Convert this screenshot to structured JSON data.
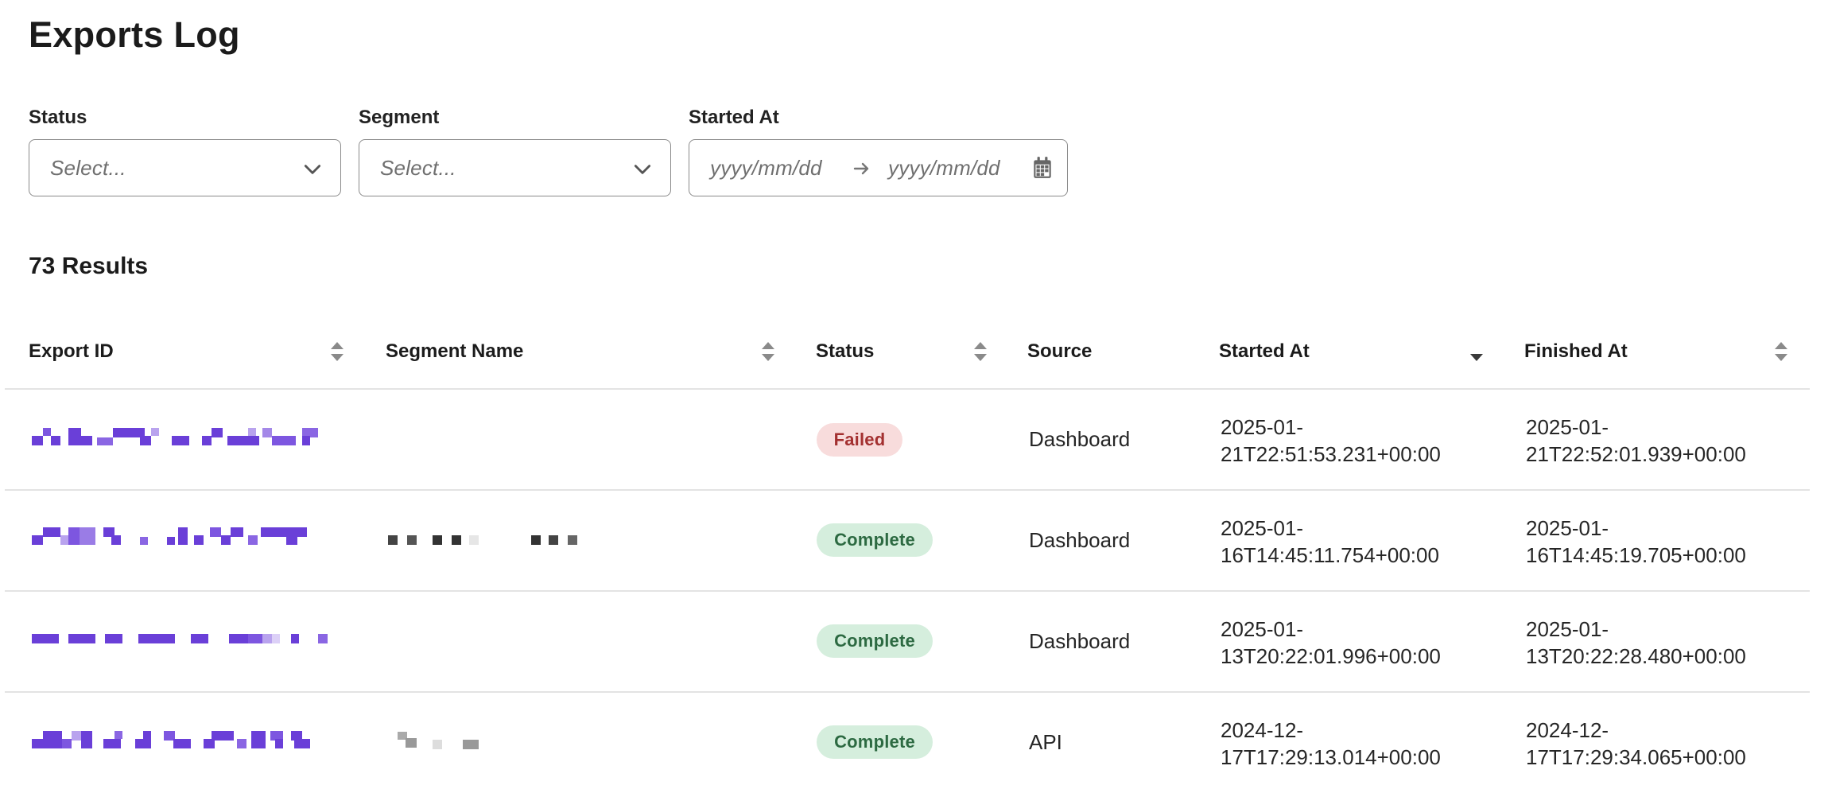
{
  "page": {
    "title": "Exports Log"
  },
  "filters": {
    "status": {
      "label": "Status",
      "placeholder": "Select..."
    },
    "segment": {
      "label": "Segment",
      "placeholder": "Select..."
    },
    "started_at": {
      "label": "Started At",
      "from_placeholder": "yyyy/mm/dd",
      "to_placeholder": "yyyy/mm/dd"
    }
  },
  "results_count": "73 Results",
  "table": {
    "columns": [
      {
        "label": "Export ID",
        "sort": "unsorted"
      },
      {
        "label": "Segment Name",
        "sort": "unsorted"
      },
      {
        "label": "Status",
        "sort": "unsorted"
      },
      {
        "label": "Source",
        "sort": "none"
      },
      {
        "label": "Started At",
        "sort": "descending"
      },
      {
        "label": "Finished At",
        "sort": "unsorted"
      }
    ],
    "rows": [
      {
        "status": "Failed",
        "status_color": "#a33030",
        "source": "Dashboard",
        "started_line1": "2025-01-",
        "started_line2": "21T22:51:53.231+00:00",
        "finished_line1": "2025-01-",
        "finished_line2": "21T22:52:01.939+00:00"
      },
      {
        "status": "Complete",
        "status_color": "#2d6a42",
        "source": "Dashboard",
        "started_line1": "2025-01-",
        "started_line2": "16T14:45:11.754+00:00",
        "finished_line1": "2025-01-",
        "finished_line2": "16T14:45:19.705+00:00"
      },
      {
        "status": "Complete",
        "status_color": "#2d6a42",
        "source": "Dashboard",
        "started_line1": "2025-01-",
        "started_line2": "13T20:22:01.996+00:00",
        "finished_line1": "2025-01-",
        "finished_line2": "13T20:22:28.480+00:00"
      },
      {
        "status": "Complete",
        "status_color": "#2d6a42",
        "source": "API",
        "started_line1": "2024-12-",
        "started_line2": "17T17:29:13.014+00:00",
        "finished_line1": "2024-12-",
        "finished_line2": "17T17:29:34.065+00:00"
      }
    ]
  },
  "colors": {
    "link_accent": "#6a3fd8",
    "redacted_gray": "#444444"
  },
  "icons": {
    "select_chevron": "chevron-down-icon",
    "date_arrow": "arrow-right-icon",
    "date_picker": "calendar-icon",
    "sort": "sort-icon"
  }
}
